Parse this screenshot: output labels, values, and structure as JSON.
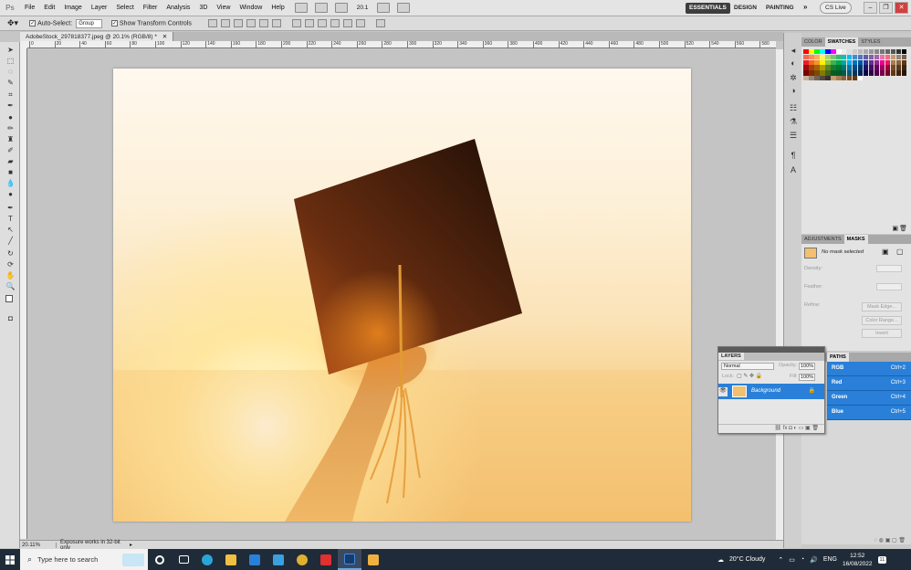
{
  "menubar": {
    "logo": "Ps",
    "items": [
      "File",
      "Edit",
      "Image",
      "Layer",
      "Select",
      "Filter",
      "Analysis",
      "3D",
      "View",
      "Window",
      "Help"
    ],
    "zoom": "20.1",
    "workspaces": {
      "essentials": "ESSENTIALS",
      "design": "DESIGN",
      "painting": "PAINTING",
      "more": "»"
    },
    "cslive": "CS Live"
  },
  "options": {
    "auto_select_label": "Auto-Select:",
    "auto_select_value": "Group",
    "show_transform_label": "Show Transform Controls"
  },
  "document": {
    "tab_title": "AdobeStock_297818377.jpeg @ 20.1% (RGB/8) *",
    "ruler_ticks": [
      "0",
      "20",
      "40",
      "60",
      "80",
      "100",
      "120",
      "140",
      "160",
      "180",
      "200",
      "220",
      "240",
      "260",
      "280",
      "300",
      "320",
      "340",
      "360",
      "380",
      "400",
      "420",
      "440",
      "460",
      "480",
      "500",
      "520",
      "540",
      "560",
      "580"
    ]
  },
  "status": {
    "zoom": "20.11%",
    "info": "Exposure works in 32-bit only"
  },
  "swatches_panel": {
    "tabs": [
      "COLOR",
      "SWATCHES",
      "STYLES"
    ],
    "active": "SWATCHES"
  },
  "masks_panel": {
    "tabs": [
      "ADJUSTMENTS",
      "MASKS"
    ],
    "active": "MASKS",
    "no_mask": "No mask selected",
    "density": "Density:",
    "feather": "Feather:",
    "refine": "Refine:",
    "mask_edge": "Mask Edge...",
    "color_range": "Color Range...",
    "invert": "Invert"
  },
  "channels_panel": {
    "paths_tab": "PATHS",
    "channels": [
      {
        "name": "RGB",
        "shortcut": "Ctrl+2"
      },
      {
        "name": "Red",
        "shortcut": "Ctrl+3"
      },
      {
        "name": "Green",
        "shortcut": "Ctrl+4"
      },
      {
        "name": "Blue",
        "shortcut": "Ctrl+5"
      }
    ]
  },
  "layers_panel": {
    "tab": "LAYERS",
    "blend_mode": "Normal",
    "opacity_label": "Opacity:",
    "opacity": "100%",
    "lock_label": "Lock:",
    "fill_label": "Fill:",
    "fill": "100%",
    "layer_name": "Background"
  },
  "taskbar": {
    "search_placeholder": "Type here to search",
    "weather": "20°C  Cloudy",
    "language": "ENG",
    "time": "12:52",
    "date": "16/08/2022",
    "notifications": "11"
  },
  "colors": {
    "accent": "#2a80d8",
    "taskbar": "#1f2b38"
  }
}
